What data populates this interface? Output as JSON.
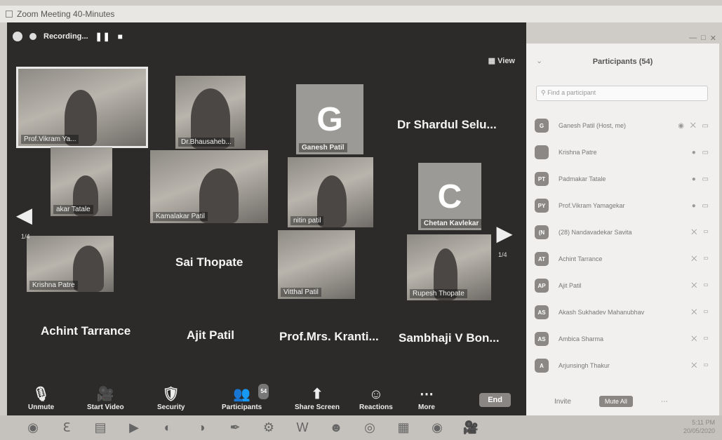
{
  "window": {
    "title": "Zoom Meeting 40-Minutes"
  },
  "topbar": {
    "recording_label": "Recording...",
    "view_label": "View"
  },
  "tiles": [
    {
      "name": "Prof.Vikram Ya...",
      "kind": "video",
      "active": true
    },
    {
      "name": "Dr.Bhausaheb...",
      "kind": "video"
    },
    {
      "name": "Ganesh Patil",
      "kind": "avatar",
      "letter": "G"
    },
    {
      "name": "Dr Shardul Selu...",
      "kind": "big"
    },
    {
      "name": "akar Tatale",
      "kind": "video"
    },
    {
      "name": "Kamalakar Patil",
      "kind": "video"
    },
    {
      "name": "nitin patil",
      "kind": "video"
    },
    {
      "name": "Chetan Kavlekar",
      "kind": "avatar",
      "letter": "C"
    },
    {
      "name": "Krishna Patre",
      "kind": "video"
    },
    {
      "name": "Sai Thopate",
      "kind": "big"
    },
    {
      "name": "Vitthal Patil",
      "kind": "video"
    },
    {
      "name": "Rupesh Thopate",
      "kind": "video"
    },
    {
      "name": "Achint Tarrance",
      "kind": "big"
    },
    {
      "name": "Ajit Patil",
      "kind": "big"
    },
    {
      "name": "Prof.Mrs. Kranti...",
      "kind": "big"
    },
    {
      "name": "Sambhaji V Bon...",
      "kind": "big"
    }
  ],
  "pager": {
    "left": "1/4",
    "right": "1/4"
  },
  "toolbar": {
    "unmute": "Unmute",
    "start_video": "Start Video",
    "security": "Security",
    "participants": "Participants",
    "participants_count": "54",
    "share_screen": "Share Screen",
    "reactions": "Reactions",
    "more": "More",
    "end": "End"
  },
  "panel": {
    "title": "Participants (54)",
    "search_placeholder": "Find a participant",
    "invite": "Invite",
    "mute_all": "Mute All",
    "participants": [
      {
        "initials": "G",
        "name": "Ganesh Patil (Host, me)"
      },
      {
        "initials": "",
        "name": "Krishna Patre"
      },
      {
        "initials": "PT",
        "name": "Padmakar Tatale"
      },
      {
        "initials": "PY",
        "name": "Prof.Vikram Yamagekar"
      },
      {
        "initials": "(N",
        "name": "(28) Nandavadekar Savita"
      },
      {
        "initials": "AT",
        "name": "Achint Tarrance"
      },
      {
        "initials": "AP",
        "name": "Ajit Patil"
      },
      {
        "initials": "AS",
        "name": "Akash Sukhadev Mahanubhav"
      },
      {
        "initials": "AS",
        "name": "Ambica Sharma"
      },
      {
        "initials": "A",
        "name": "Arjunsingh Thakur"
      }
    ]
  },
  "tray": {
    "time": "5:11 PM",
    "date": "20/05/2020"
  }
}
